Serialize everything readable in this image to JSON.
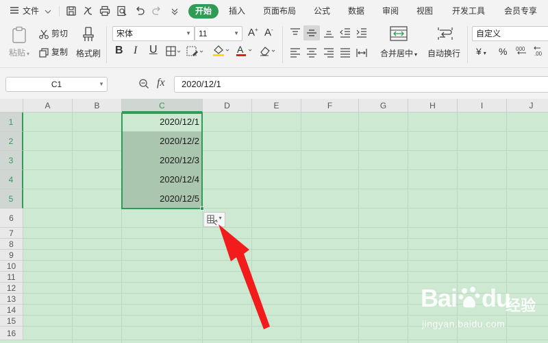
{
  "menubar": {
    "file_menu": "文件",
    "tabs": [
      "开始",
      "插入",
      "页面布局",
      "公式",
      "数据",
      "审阅",
      "视图",
      "开发工具",
      "会员专享"
    ]
  },
  "ribbon": {
    "paste": "粘贴",
    "cut": "剪切",
    "copy": "复制",
    "format_painter": "格式刷",
    "font_name": "宋体",
    "font_size": "11",
    "merge_center": "合并居中",
    "wrap_text": "自动换行",
    "number_format": "自定义",
    "currency_symbol": "¥",
    "percent_symbol": "%"
  },
  "formula_bar": {
    "name_box": "C1",
    "fx_label": "fx",
    "value": "2020/12/1"
  },
  "sheet": {
    "columns": [
      "A",
      "B",
      "C",
      "D",
      "E",
      "F",
      "G",
      "H",
      "I",
      "J"
    ],
    "selected_column": "C",
    "rows": [
      "1",
      "2",
      "3",
      "4",
      "5",
      "6",
      "7",
      "8",
      "9",
      "10",
      "11",
      "12",
      "13",
      "14",
      "15",
      "16"
    ],
    "selected_rows": [
      "1",
      "2",
      "3",
      "4",
      "5"
    ],
    "cells_c": [
      "2020/12/1",
      "2020/12/2",
      "2020/12/3",
      "2020/12/4",
      "2020/12/5"
    ]
  },
  "colors": {
    "accent_green": "#2e9c55",
    "sheet_background": "#cde9d2",
    "arrow_red": "#f21c1c"
  },
  "watermark": {
    "brand": "Bai",
    "brand_suffix": "du",
    "product": "经验",
    "url": "jingyan.baidu.com"
  }
}
